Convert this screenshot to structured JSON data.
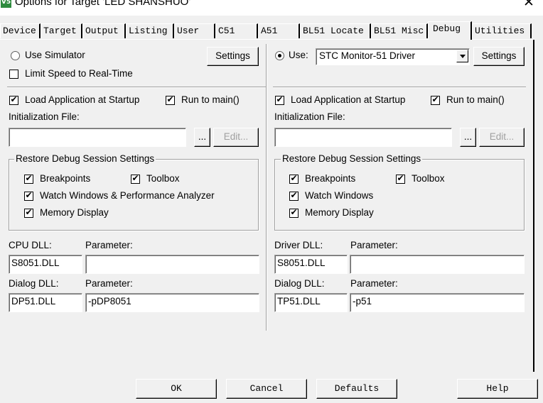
{
  "window": {
    "title": "Options for Target 'LED SHANSHUO'",
    "close_glyph": "✕",
    "icon_text": "V5"
  },
  "tabs": [
    {
      "label": "Device",
      "active": false
    },
    {
      "label": "Target",
      "active": false
    },
    {
      "label": "Output",
      "active": false
    },
    {
      "label": "Listing",
      "active": false
    },
    {
      "label": "User",
      "active": false
    },
    {
      "label": "C51",
      "active": false
    },
    {
      "label": "A51",
      "active": false
    },
    {
      "label": "BL51 Locate",
      "active": false
    },
    {
      "label": "BL51 Misc",
      "active": false
    },
    {
      "label": "Debug",
      "active": true
    },
    {
      "label": "Utilities",
      "active": false
    }
  ],
  "left": {
    "use_simulator_label": "Use Simulator",
    "use_simulator_selected": false,
    "settings_label": "Settings",
    "limit_speed_label": "Limit Speed to Real-Time",
    "limit_speed_checked": false,
    "load_app_label": "Load Application at Startup",
    "load_app_checked": true,
    "run_to_main_label": "Run to main()",
    "run_to_main_checked": true,
    "init_file_label": "Initialization File:",
    "init_file_value": "",
    "browse_label": "...",
    "edit_label": "Edit...",
    "restore_group_title": "Restore Debug Session Settings",
    "breakpoints_label": "Breakpoints",
    "toolbox_label": "Toolbox",
    "watch_label": "Watch Windows & Performance Analyzer",
    "memory_label": "Memory Display",
    "cpu_dll_label": "CPU DLL:",
    "cpu_param_label": "Parameter:",
    "cpu_dll_value": "S8051.DLL",
    "cpu_param_value": "",
    "dialog_dll_label": "Dialog DLL:",
    "dialog_param_label": "Parameter:",
    "dialog_dll_value": "DP51.DLL",
    "dialog_param_value": "-pDP8051"
  },
  "right": {
    "use_label": "Use:",
    "use_selected": true,
    "driver_value": "STC Monitor-51 Driver",
    "settings_label": "Settings",
    "load_app_label": "Load Application at Startup",
    "load_app_checked": true,
    "run_to_main_label": "Run to main()",
    "run_to_main_checked": true,
    "init_file_label": "Initialization File:",
    "init_file_value": "",
    "browse_label": "...",
    "edit_label": "Edit...",
    "restore_group_title": "Restore Debug Session Settings",
    "breakpoints_label": "Breakpoints",
    "toolbox_label": "Toolbox",
    "watch_label": "Watch Windows",
    "memory_label": "Memory Display",
    "driver_dll_label": "Driver DLL:",
    "driver_param_label": "Parameter:",
    "driver_dll_value": "S8051.DLL",
    "driver_param_value": "",
    "dialog_dll_label": "Dialog DLL:",
    "dialog_param_label": "Parameter:",
    "dialog_dll_value": "TP51.DLL",
    "dialog_param_value": "-p51"
  },
  "footer": {
    "ok_label": "OK",
    "cancel_label": "Cancel",
    "defaults_label": "Defaults",
    "help_label": "Help"
  }
}
